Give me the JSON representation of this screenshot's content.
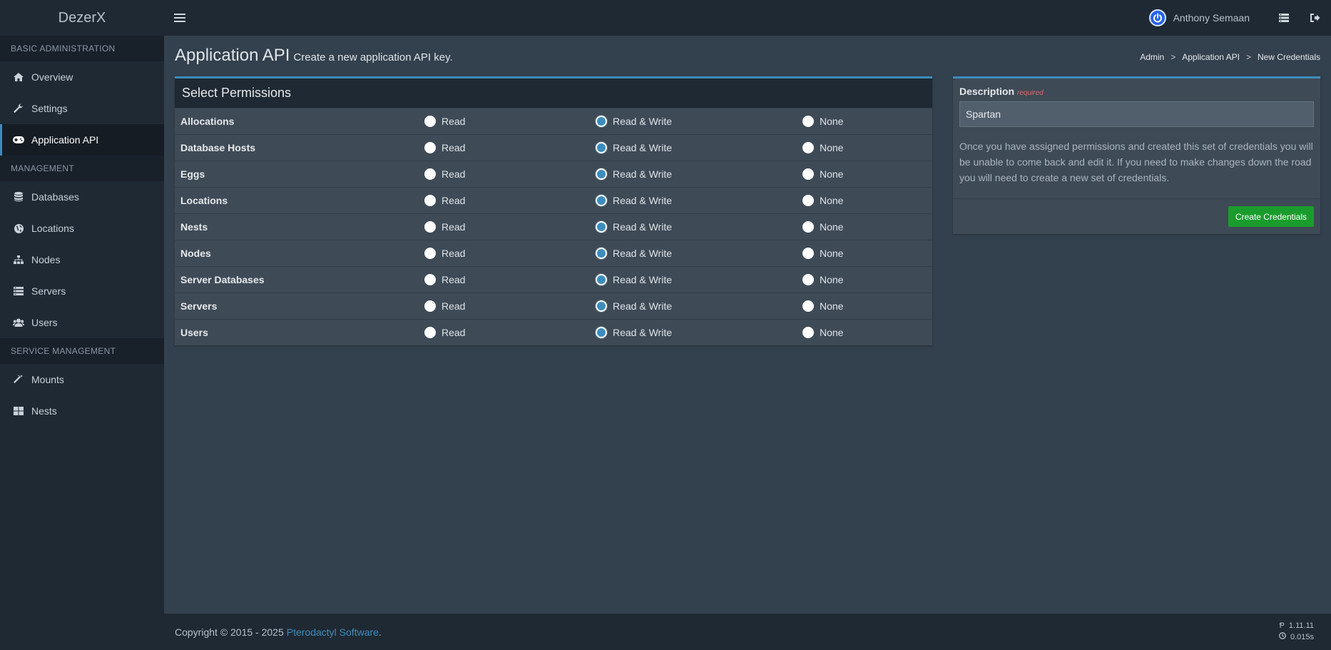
{
  "brand": "DezerX",
  "user": {
    "name": "Anthony Semaan"
  },
  "sidebar": {
    "sections": [
      {
        "header": "BASIC ADMINISTRATION",
        "items": [
          {
            "label": "Overview",
            "icon": "home-icon"
          },
          {
            "label": "Settings",
            "icon": "wrench-icon"
          },
          {
            "label": "Application API",
            "icon": "gamepad-icon",
            "active": true
          }
        ]
      },
      {
        "header": "MANAGEMENT",
        "items": [
          {
            "label": "Databases",
            "icon": "database-icon"
          },
          {
            "label": "Locations",
            "icon": "globe-icon"
          },
          {
            "label": "Nodes",
            "icon": "sitemap-icon"
          },
          {
            "label": "Servers",
            "icon": "server-icon"
          },
          {
            "label": "Users",
            "icon": "users-icon"
          }
        ]
      },
      {
        "header": "SERVICE MANAGEMENT",
        "items": [
          {
            "label": "Mounts",
            "icon": "magic-icon"
          },
          {
            "label": "Nests",
            "icon": "th-large-icon"
          }
        ]
      }
    ]
  },
  "page": {
    "title": "Application API",
    "subtitle": "Create a new application API key.",
    "breadcrumb": [
      "Admin",
      "Application API",
      "New Credentials"
    ]
  },
  "permissions": {
    "title": "Select Permissions",
    "options": [
      "Read",
      "Read & Write",
      "None"
    ],
    "rows": [
      {
        "name": "Allocations",
        "selected": "Read & Write"
      },
      {
        "name": "Database Hosts",
        "selected": "Read & Write"
      },
      {
        "name": "Eggs",
        "selected": "Read & Write"
      },
      {
        "name": "Locations",
        "selected": "Read & Write"
      },
      {
        "name": "Nests",
        "selected": "Read & Write"
      },
      {
        "name": "Nodes",
        "selected": "Read & Write"
      },
      {
        "name": "Server Databases",
        "selected": "Read & Write"
      },
      {
        "name": "Servers",
        "selected": "Read & Write"
      },
      {
        "name": "Users",
        "selected": "Read & Write"
      }
    ]
  },
  "description": {
    "label": "Description",
    "required": "required",
    "value": "Spartan",
    "help": "Once you have assigned permissions and created this set of credentials you will be unable to come back and edit it. If you need to make changes down the road you will need to create a new set of credentials.",
    "button": "Create Credentials"
  },
  "footer": {
    "copyright": "Copyright © 2015 - 2025",
    "link": "Pterodactyl Software",
    "link_suffix": ".",
    "version": "1.11.11",
    "time": "0.015s"
  },
  "colors": {
    "accent": "#3c8dbc",
    "success": "#1a9c2c",
    "sidebar": "#1f2933",
    "content": "#33404d"
  }
}
